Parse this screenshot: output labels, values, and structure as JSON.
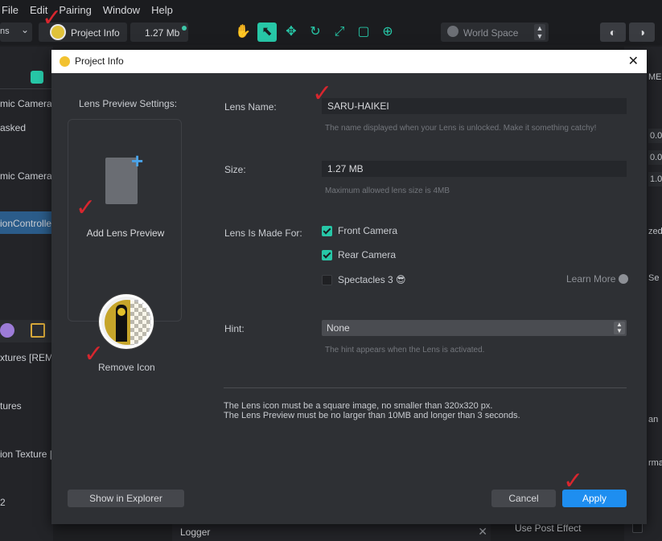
{
  "menubar": {
    "items": [
      "File",
      "Edit",
      "Pairing",
      "Window",
      "Help"
    ]
  },
  "toolbar": {
    "left_dropdown_text": "ns",
    "project_info_label": "Project Info",
    "project_size": "1.27 Mb",
    "space_dropdown": "World Space",
    "tools": [
      "hand-icon",
      "select-icon",
      "move-icon",
      "rotate-icon",
      "scale-icon",
      "rect-icon",
      "target-icon"
    ]
  },
  "left_panel": {
    "items": [
      "mic Camera M",
      "asked",
      "mic Camera",
      "ionControlle",
      "xtures [REM",
      "tures",
      "ion Texture [",
      "2"
    ]
  },
  "right_panel": {
    "labels": [
      "ME",
      "0.0",
      "0.0",
      "1.0",
      "zed",
      "Se",
      "an",
      "rma"
    ]
  },
  "dialog": {
    "title": "Project Info",
    "left": {
      "preview_heading": "Lens Preview Settings:",
      "add_preview": "Add Lens Preview",
      "remove_icon": "Remove Icon",
      "show_explorer": "Show in Explorer"
    },
    "lens_name_label": "Lens Name:",
    "lens_name_value": "SARU-HAIKEI",
    "lens_name_hint": "The name displayed when your Lens is unlocked. Make it something catchy!",
    "size_label": "Size:",
    "size_value": "1.27 MB",
    "size_hint": "Maximum allowed lens size is 4MB",
    "made_for_label": "Lens Is Made For:",
    "front_camera": "Front Camera",
    "rear_camera": "Rear Camera",
    "spectacles": "Spectacles 3",
    "learn_more": "Learn More",
    "hint_label": "Hint:",
    "hint_value": "None",
    "hint_hint": "The hint appears when the Lens is activated.",
    "note_line1": "The Lens icon must be a square image, no smaller than 320x320 px.",
    "note_line2": "The Lens Preview must be no larger than 10MB and longer than 3 seconds.",
    "cancel": "Cancel",
    "apply": "Apply"
  },
  "bottom": {
    "logger": "Logger",
    "post_effect": "Use Post Effect"
  },
  "colors": {
    "accent": "#27c7a7",
    "apply": "#1e8ef0",
    "annotation": "#d7262e"
  }
}
